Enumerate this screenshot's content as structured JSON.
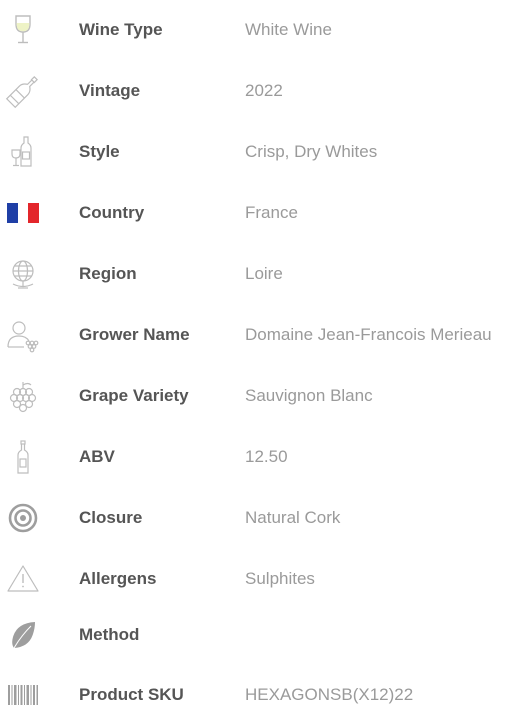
{
  "colors": {
    "label": "#555555",
    "value": "#9a9a9a",
    "icon": "#bdbdbd",
    "flag_blue": "#1f3fa6",
    "flag_red": "#e3262b"
  },
  "rows": [
    {
      "icon": "wine-glass-icon",
      "label": "Wine Type",
      "value": "White Wine"
    },
    {
      "icon": "wine-bottle-icon",
      "label": "Vintage",
      "value": "2022"
    },
    {
      "icon": "bottle-and-glass-icon",
      "label": "Style",
      "value": "Crisp, Dry Whites"
    },
    {
      "icon": "france-flag-icon",
      "label": "Country",
      "value": "France"
    },
    {
      "icon": "globe-icon",
      "label": "Region",
      "value": "Loire"
    },
    {
      "icon": "grower-icon",
      "label": "Grower Name",
      "value": "Domaine Jean-Francois Merieau"
    },
    {
      "icon": "grapes-icon",
      "label": "Grape Variety",
      "value": "Sauvignon Blanc"
    },
    {
      "icon": "bottle-icon",
      "label": "ABV",
      "value": "12.50"
    },
    {
      "icon": "cork-icon",
      "label": "Closure",
      "value": "Natural Cork"
    },
    {
      "icon": "warning-icon",
      "label": "Allergens",
      "value": "Sulphites"
    },
    {
      "icon": "leaf-icon",
      "label": "Method",
      "value": ""
    },
    {
      "icon": "barcode-icon",
      "label": "Product SKU",
      "value": "HEXAGONSB(X12)22"
    }
  ]
}
